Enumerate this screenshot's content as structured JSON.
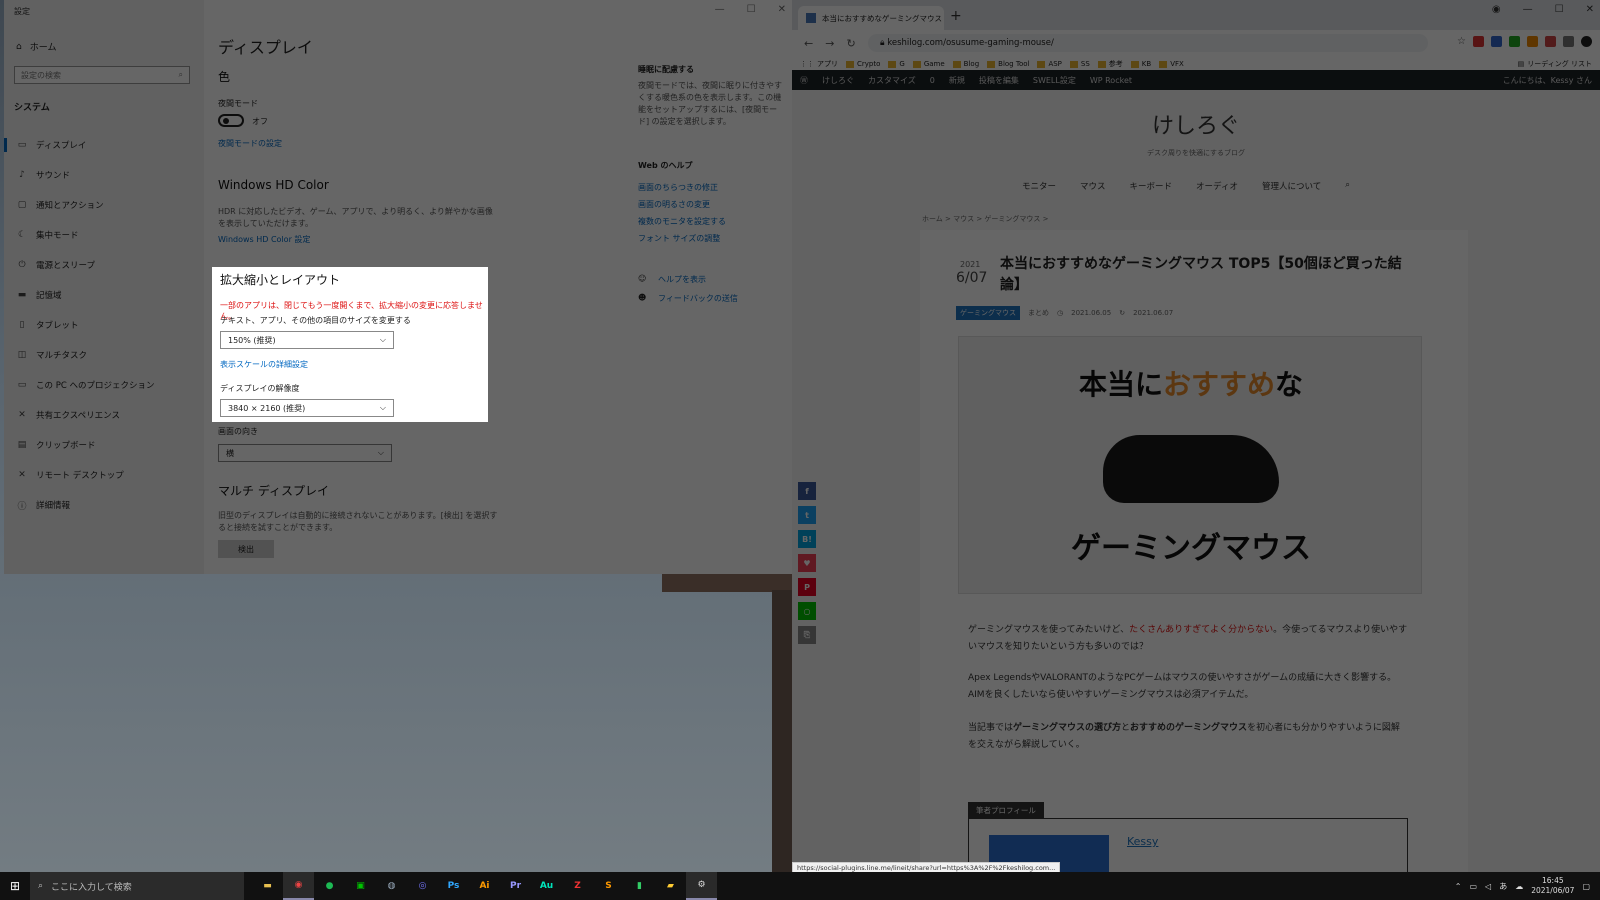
{
  "settings": {
    "window_title": "設定",
    "nav": {
      "home": "ホーム",
      "search_placeholder": "設定の検索",
      "section": "システム",
      "items": [
        "ディスプレイ",
        "サウンド",
        "通知とアクション",
        "集中モード",
        "電源とスリープ",
        "記憶域",
        "タブレット",
        "マルチタスク",
        "この PC へのプロジェクション",
        "共有エクスペリエンス",
        "クリップボード",
        "リモート デスクトップ",
        "詳細情報"
      ]
    },
    "main": {
      "title": "ディスプレイ",
      "color_heading": "色",
      "night_mode_label": "夜間モード",
      "night_mode_state": "オフ",
      "night_mode_link": "夜間モードの設定",
      "hdr_heading": "Windows HD Color",
      "hdr_desc": "HDR に対応したビデオ、ゲーム、アプリで、より明るく、より鮮やかな画像を表示していただけます。",
      "hdr_link": "Windows HD Color 設定",
      "scale_heading": "拡大縮小とレイアウト",
      "scale_warning": "一部のアプリは、閉じてもう一度開くまで、拡大縮小の変更に応答しません。",
      "scale_label": "テキスト、アプリ、その他の項目のサイズを変更する",
      "scale_value": "150% (推奨)",
      "scale_link": "表示スケールの詳細設定",
      "resolution_label": "ディスプレイの解像度",
      "resolution_value": "3840 × 2160 (推奨)",
      "orientation_label": "画面の向き",
      "orientation_value": "横",
      "multi_heading": "マルチ ディスプレイ",
      "multi_desc": "旧型のディスプレイは自動的に接続されないことがあります。[検出] を選択すると接続を試すことができます。",
      "detect_button": "検出"
    },
    "side": {
      "sleep_heading": "睡眠に配慮する",
      "sleep_desc": "夜間モードでは、夜間に眠りに付きやすくする暖色系の色を表示します。この機能をセットアップするには、[夜間モード] の設定を選択します。",
      "help_heading": "Web のヘルプ",
      "help_links": [
        "画面のちらつきの修正",
        "画面の明るさの変更",
        "複数のモニタを設定する",
        "フォント サイズの調整"
      ],
      "show_help": "ヘルプを表示",
      "feedback": "フィードバックの送信"
    }
  },
  "browser": {
    "tab_title": "本当におすすめなゲーミングマウス TO",
    "url": "keshilog.com/osusume-gaming-mouse/",
    "bookmarks": [
      "アプリ",
      "Crypto",
      "G",
      "Game",
      "Blog",
      "Blog Tool",
      "ASP",
      "SS",
      "参考",
      "KB",
      "VFX",
      "リーディング リスト"
    ],
    "wp_bar": {
      "site": "けしろぐ",
      "customize": "カスタマイズ",
      "comments": "0",
      "new": "新規",
      "edit": "投稿を編集",
      "swell": "SWELL設定",
      "rocket": "WP Rocket",
      "greeting": "こんにちは、Kessy さん"
    },
    "site_name": "けしろぐ",
    "tagline": "デスク周りを快適にするブログ",
    "menu": [
      "モニター",
      "マウス",
      "キーボード",
      "オーディオ",
      "管理人について"
    ],
    "breadcrumb": "ホーム > マウス > ゲーミングマウス >",
    "article": {
      "year": "2021",
      "date": "6/07",
      "title": "本当におすすめなゲーミングマウス TOP5【50個ほど買った結論】",
      "category": "ゲーミングマウス",
      "tag": "まとめ",
      "published": "2021.06.05",
      "updated": "2021.06.07",
      "hero_pre": "本当に",
      "hero_accent": "おすすめ",
      "hero_post": "な",
      "hero_bottom": "ゲーミングマウス",
      "p1a": "ゲーミングマウスを使ってみたいけど、",
      "p1b": "たくさんありすぎてよく分からない",
      "p1c": "。今使ってるマウスより使いやすいマウスを知りたいという方も多いのでは？",
      "p2": "Apex LegendsやVALORANTのようなPCゲームはマウスの使いやすさがゲームの成績に大きく影響する。AIMを良くしたいなら使いやすいゲーミングマウスは必須アイテムだ。",
      "p3a": "当記事では",
      "p3b": "ゲーミングマウスの選び方",
      "p3c": "と",
      "p3d": "おすすめのゲーミングマウス",
      "p3e": "を初心者にも分かりやすいように図解を交えながら解説していく。",
      "profile_head": "筆者プロフィール",
      "profile_name": "Kessy"
    },
    "status_url": "https://social-plugins.line.me/lineit/share?url=https%3A%2F%2Fkeshilog.com..."
  },
  "taskbar": {
    "search_placeholder": "ここに入力して検索",
    "apps": [
      "Ps",
      "Ai",
      "Pr",
      "Au"
    ],
    "time": "16:45",
    "date": "2021/06/07",
    "ime": "あ"
  },
  "colors": {
    "accent": "#0067c0",
    "warning": "#dd1111",
    "wp_bar": "#1d2327",
    "hero_accent": "#e58a2b"
  }
}
